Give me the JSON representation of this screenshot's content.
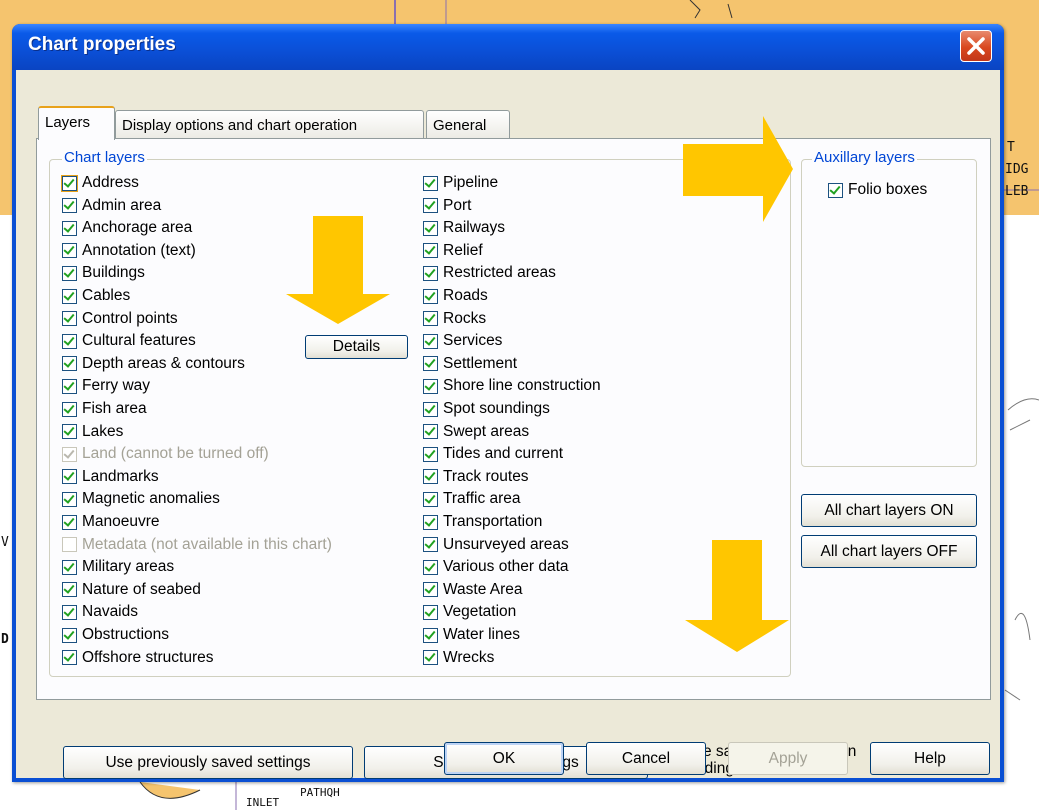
{
  "background": {
    "texts": [
      "T",
      "IDG",
      "LEB",
      "V",
      "D",
      "INLET",
      "PATHQH"
    ]
  },
  "window": {
    "title": "Chart properties",
    "close_icon": "close-icon"
  },
  "tabs": [
    {
      "label": "Layers",
      "active": true
    },
    {
      "label": "Display options and chart operation",
      "active": false
    },
    {
      "label": "General",
      "active": false
    }
  ],
  "chart_layers": {
    "legend": "Chart layers",
    "column1": [
      {
        "label": "Address",
        "checked": true,
        "disabled": false
      },
      {
        "label": "Admin area",
        "checked": true,
        "disabled": false
      },
      {
        "label": "Anchorage area",
        "checked": true,
        "disabled": false
      },
      {
        "label": "Annotation (text)",
        "checked": true,
        "disabled": false
      },
      {
        "label": "Buildings",
        "checked": true,
        "disabled": false
      },
      {
        "label": "Cables",
        "checked": true,
        "disabled": false
      },
      {
        "label": "Control points",
        "checked": true,
        "disabled": false
      },
      {
        "label": "Cultural features",
        "checked": true,
        "disabled": false
      },
      {
        "label": "Depth areas & contours",
        "checked": true,
        "disabled": false
      },
      {
        "label": "Ferry way",
        "checked": true,
        "disabled": false
      },
      {
        "label": "Fish area",
        "checked": true,
        "disabled": false
      },
      {
        "label": "Lakes",
        "checked": true,
        "disabled": false
      },
      {
        "label": "Land (cannot be turned off)",
        "checked": true,
        "disabled": true
      },
      {
        "label": "Landmarks",
        "checked": true,
        "disabled": false
      },
      {
        "label": "Magnetic anomalies",
        "checked": true,
        "disabled": false
      },
      {
        "label": "Manoeuvre",
        "checked": true,
        "disabled": false
      },
      {
        "label": "Metadata (not available in this chart)",
        "checked": false,
        "disabled": true
      },
      {
        "label": "Military areas",
        "checked": true,
        "disabled": false
      },
      {
        "label": "Nature of seabed",
        "checked": true,
        "disabled": false
      },
      {
        "label": "Navaids",
        "checked": true,
        "disabled": false
      },
      {
        "label": "Obstructions",
        "checked": true,
        "disabled": false
      },
      {
        "label": "Offshore structures",
        "checked": true,
        "disabled": false
      }
    ],
    "column2": [
      {
        "label": "Pipeline",
        "checked": true,
        "disabled": false
      },
      {
        "label": "Port",
        "checked": true,
        "disabled": false
      },
      {
        "label": "Railways",
        "checked": true,
        "disabled": false
      },
      {
        "label": "Relief",
        "checked": true,
        "disabled": false
      },
      {
        "label": "Restricted areas",
        "checked": true,
        "disabled": false
      },
      {
        "label": "Roads",
        "checked": true,
        "disabled": false
      },
      {
        "label": "Rocks",
        "checked": true,
        "disabled": false
      },
      {
        "label": "Services",
        "checked": true,
        "disabled": false
      },
      {
        "label": "Settlement",
        "checked": true,
        "disabled": false
      },
      {
        "label": "Shore line construction",
        "checked": true,
        "disabled": false
      },
      {
        "label": "Spot soundings",
        "checked": true,
        "disabled": false
      },
      {
        "label": "Swept areas",
        "checked": true,
        "disabled": false
      },
      {
        "label": "Tides and current",
        "checked": true,
        "disabled": false
      },
      {
        "label": "Track routes",
        "checked": true,
        "disabled": false
      },
      {
        "label": "Traffic area",
        "checked": true,
        "disabled": false
      },
      {
        "label": "Transportation",
        "checked": true,
        "disabled": false
      },
      {
        "label": "Unsurveyed areas",
        "checked": true,
        "disabled": false
      },
      {
        "label": "Various other data",
        "checked": true,
        "disabled": false
      },
      {
        "label": "Waste Area",
        "checked": true,
        "disabled": false
      },
      {
        "label": "Vegetation",
        "checked": true,
        "disabled": false
      },
      {
        "label": "Water lines",
        "checked": true,
        "disabled": false
      },
      {
        "label": "Wrecks",
        "checked": true,
        "disabled": false
      }
    ],
    "details_button": "Details"
  },
  "auxiliary_layers": {
    "legend": "Auxillary layers",
    "items": [
      {
        "label": "Folio boxes",
        "checked": true
      }
    ]
  },
  "layer_buttons": {
    "all_on": "All chart layers ON",
    "all_off": "All chart layers OFF"
  },
  "settings": {
    "use_previous": "Use previously saved settings",
    "save_current": "Save current settings",
    "use_saved_line1": "Use saved settings when",
    "use_saved_line2": "loading a chart.",
    "use_saved_checked": true
  },
  "dialog_buttons": {
    "ok": "OK",
    "cancel": "Cancel",
    "apply": "Apply",
    "help": "Help"
  },
  "colors": {
    "arrow": "#ffc600",
    "map_land": "#f5c46e",
    "title_bar": "#0a4fd3",
    "check": "#21a121"
  }
}
